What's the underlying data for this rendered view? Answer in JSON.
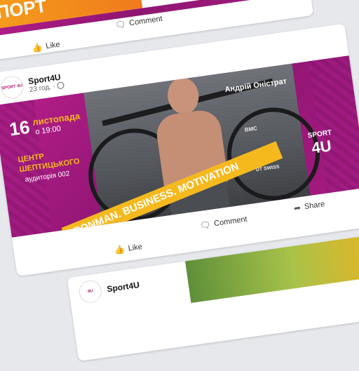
{
  "top_post": {
    "banner_text": "СПОРТ",
    "actions": {
      "comment": "Comment",
      "like": "Like"
    }
  },
  "main_post": {
    "author": "Sport4U",
    "time": "23 год. ·",
    "avatar_text": "SPORT 4U",
    "banner": {
      "day": "16",
      "month": "листопада",
      "time": "о 19:00",
      "venue_line1": "ЦЕНТР",
      "venue_line2": "ШЕПТИЦЬКОГО",
      "room": "аудиторія 002",
      "speaker": "Андрій Оністрат",
      "slogan": "IRONMAN. BUSINESS. MOTIVATION",
      "logo_top": "SPORT",
      "logo_bottom": "4U",
      "bike_brand": "BMC",
      "wheel_brand": "DT SWISS"
    },
    "actions": {
      "share": "Share",
      "comment": "Comment",
      "like": "Like"
    }
  },
  "third_post": {
    "author": "Sport4U"
  },
  "colors": {
    "magenta": "#a61b80",
    "yellow": "#f5b91e",
    "orange": "#f07a1c"
  }
}
